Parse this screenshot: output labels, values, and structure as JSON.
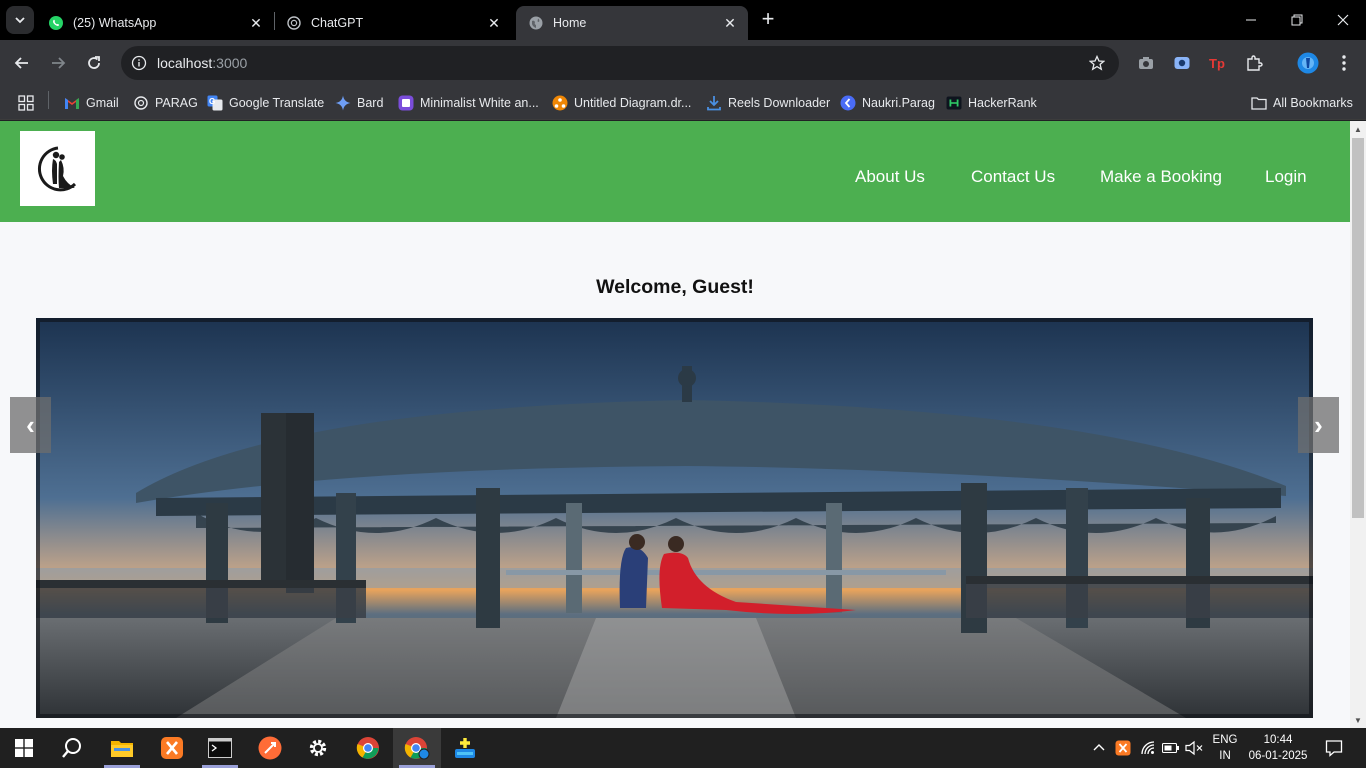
{
  "browser": {
    "tabs": [
      {
        "title": "(25) WhatsApp",
        "icon": "whatsapp-icon"
      },
      {
        "title": "ChatGPT",
        "icon": "chatgpt-icon"
      },
      {
        "title": "Home",
        "icon": "globe-icon",
        "active": true
      }
    ],
    "address": {
      "host": "localhost",
      "port": ":3000"
    },
    "bookmarks": [
      {
        "label": "Gmail",
        "icon": "gmail-icon"
      },
      {
        "label": "PARAG",
        "icon": "chatgpt-icon"
      },
      {
        "label": "Google Translate",
        "icon": "google-translate-icon"
      },
      {
        "label": "Bard",
        "icon": "bard-icon"
      },
      {
        "label": "Minimalist White an...",
        "icon": "canva-icon"
      },
      {
        "label": "Untitled Diagram.dr...",
        "icon": "drawio-icon"
      },
      {
        "label": "Reels Downloader",
        "icon": "download-icon"
      },
      {
        "label": "Naukri.Parag",
        "icon": "naukri-icon"
      },
      {
        "label": "HackerRank",
        "icon": "hackerrank-icon"
      }
    ],
    "all_bookmarks": "All Bookmarks"
  },
  "site": {
    "nav_links": [
      "About Us",
      "Contact Us",
      "Make a Booking",
      "Login"
    ],
    "welcome": "Welcome, Guest!",
    "carousel": {
      "prev_label": "‹",
      "next_label": "›"
    }
  },
  "taskbar": {
    "language": {
      "line1": "ENG",
      "line2": "IN"
    },
    "time": "10:44",
    "date": "06-01-2025"
  },
  "colors": {
    "site_nav": "#4caf50",
    "page_bg": "#f7f8fa",
    "browser_frame": "#35363a",
    "taskbar": "#202020"
  }
}
